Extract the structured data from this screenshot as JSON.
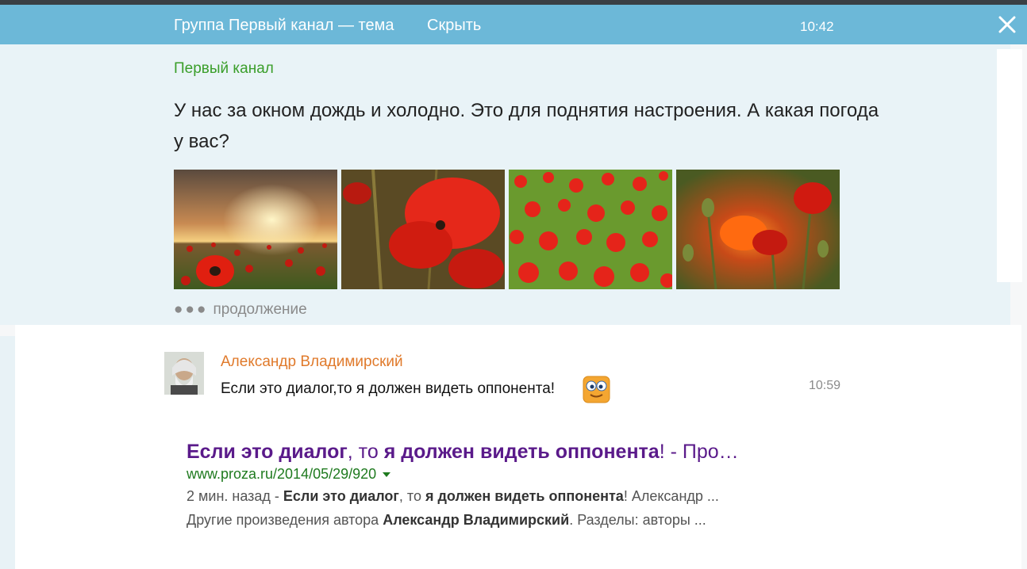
{
  "header": {
    "title": "Группа Первый канал — тема",
    "hide_label": "Скрыть",
    "time": "10:42",
    "close_icon": "close-icon"
  },
  "topic": {
    "group_name": "Первый канал",
    "text": "У нас за окном дождь и холодно. Это для поднятия настроения. А какая погода у вас?",
    "photos": [
      "poppy-field-sunset",
      "poppy-closeup",
      "poppy-field",
      "poppy-buds-sunset"
    ],
    "more_label": "продолжение"
  },
  "comment": {
    "author": "Александр Владимирский",
    "text": "Если это диалог,то я должен видеть оппонента!",
    "time": "10:59",
    "emoji_icon": "smiley-icon"
  },
  "search_result": {
    "title_parts": [
      {
        "t": "Если это диалог",
        "b": true
      },
      {
        "t": ", то ",
        "b": false
      },
      {
        "t": "я должен видеть оппонента",
        "b": true
      },
      {
        "t": "! - Про…",
        "b": false
      }
    ],
    "url": "www.proza.ru/2014/05/29/920",
    "snippet1": [
      {
        "t": "2 мин. назад - ",
        "b": false
      },
      {
        "t": "Если это диалог",
        "b": true
      },
      {
        "t": ", то ",
        "b": false
      },
      {
        "t": "я должен видеть оппонента",
        "b": true
      },
      {
        "t": "! Александр ...",
        "b": false
      }
    ],
    "snippet2": [
      {
        "t": "Другие произведения автора ",
        "b": false
      },
      {
        "t": "Александр Владимирский",
        "b": true
      },
      {
        "t": ". Разделы: авторы ...",
        "b": false
      }
    ]
  },
  "colors": {
    "header_bg": "#6cb8d8",
    "group_green": "#3a9e2a",
    "author_orange": "#e07a2b",
    "link_purple": "#5a1a8a",
    "url_green": "#1f7a1f"
  }
}
